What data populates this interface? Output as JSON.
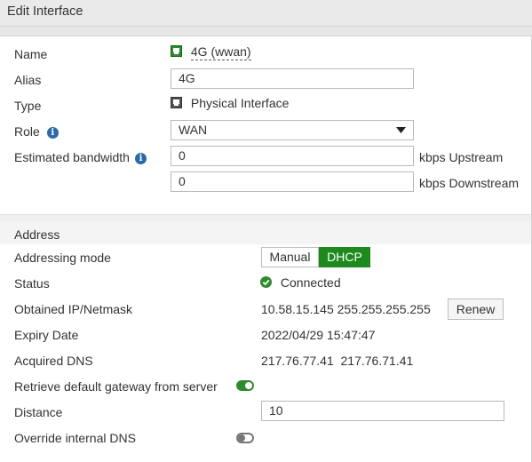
{
  "window": {
    "title": "Edit Interface"
  },
  "interface": {
    "name_label": "Name",
    "name_value": "4G (wwan)",
    "alias_label": "Alias",
    "alias_value": "4G",
    "type_label": "Type",
    "type_value": "Physical Interface",
    "role_label": "Role",
    "role_value": "WAN",
    "bandwidth_label": "Estimated bandwidth",
    "upstream_value": "0",
    "upstream_unit": "kbps Upstream",
    "downstream_value": "0",
    "downstream_unit": "kbps Downstream"
  },
  "address": {
    "section_title": "Address",
    "mode_label": "Addressing mode",
    "mode_options": [
      "Manual",
      "DHCP"
    ],
    "mode_selected": "DHCP",
    "status_label": "Status",
    "status_value": "Connected",
    "ip_label": "Obtained IP/Netmask",
    "ip_value": "10.58.15.145 255.255.255.255",
    "renew_label": "Renew",
    "expiry_label": "Expiry Date",
    "expiry_value": "2022/04/29 15:47:47",
    "dns_label": "Acquired DNS",
    "dns_value": "217.76.77.41  217.76.71.41",
    "gateway_label": "Retrieve default gateway from server",
    "gateway_enabled": true,
    "distance_label": "Distance",
    "distance_value": "10",
    "override_dns_label": "Override internal DNS",
    "override_dns_enabled": false
  },
  "colors": {
    "accent_green": "#1e8a1e",
    "info_blue": "#2b6aa6",
    "toggle_on": "#2e8b2e"
  },
  "icons": {
    "interface": "network-port-icon",
    "type": "physical-port-icon",
    "info": "info-icon",
    "status": "check-circle-icon",
    "dropdown": "caret-down-icon"
  }
}
